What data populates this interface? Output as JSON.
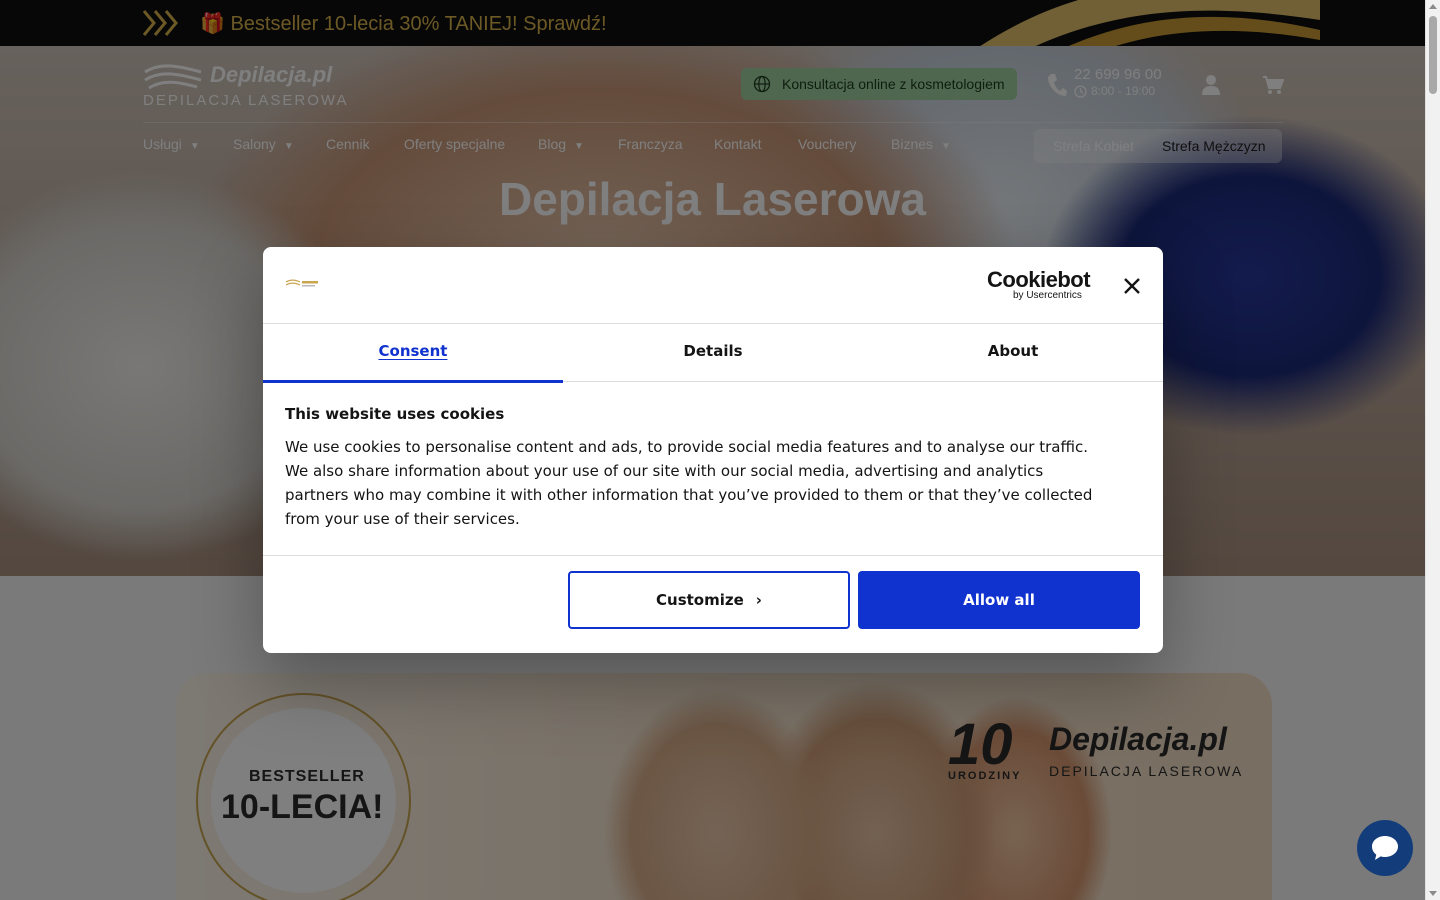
{
  "promo": {
    "text": "🎁 Bestseller 10-lecia 30% TANIEJ! Sprawdź!"
  },
  "header": {
    "logo_name": "Depilacja.pl",
    "logo_sub": "DEPILACJA LASEROWA",
    "consult_label": "Konsultacja online z kosmetologiem",
    "phone": "22 699 96 00",
    "hours": "8:00 - 19:00"
  },
  "nav": {
    "items": [
      {
        "label": "Usługi",
        "has_caret": true
      },
      {
        "label": "Salony",
        "has_caret": true
      },
      {
        "label": "Cennik",
        "has_caret": false
      },
      {
        "label": "Oferty specjalne",
        "has_caret": false
      },
      {
        "label": "Blog",
        "has_caret": true
      },
      {
        "label": "Franczyza",
        "has_caret": false
      },
      {
        "label": "Kontakt",
        "has_caret": false
      },
      {
        "label": "Vouchery",
        "has_caret": false
      },
      {
        "label": "Biznes",
        "has_caret": true
      }
    ],
    "caret": "▼",
    "zones": {
      "women": "Strefa Kobiet",
      "men": "Strefa Mężczyzn"
    }
  },
  "hero": {
    "title": "Depilacja Laserowa"
  },
  "banner": {
    "badge_line1": "BESTSELLER",
    "badge_line2": "10-LECIA!",
    "logo_ten": "10",
    "logo_uro": "URODZINY",
    "logo_name": "Depilacja.pl",
    "logo_sub": "DEPILACJA LASEROWA"
  },
  "cookie_dialog": {
    "provider_name": "Cookiebot",
    "provider_sub": "by Usercentrics",
    "tabs": [
      {
        "label": "Consent",
        "active": true
      },
      {
        "label": "Details",
        "active": false
      },
      {
        "label": "About",
        "active": false
      }
    ],
    "heading": "This website uses cookies",
    "body": "We use cookies to personalise content and ads, to provide social media features and to analyse our traffic. We also share information about your use of our site with our social media, advertising and analytics partners who may combine it with other information that you’ve provided to them or that they’ve collected from your use of their services.",
    "customize_label": "Customize",
    "customize_chevron": "›",
    "allow_all_label": "Allow all"
  },
  "colors": {
    "accent": "#1032cf",
    "promo_gold": "#d8b24a",
    "consult_green": "#9fcf9f",
    "chat_blue": "#123d7a"
  },
  "icons": {
    "promo": "chevrons-right-icon",
    "consult": "globe-icon",
    "phone": "phone-icon",
    "hours": "clock-icon",
    "account": "user-icon",
    "cart": "cart-icon",
    "close": "close-icon",
    "chat": "chat-bubble-icon"
  }
}
